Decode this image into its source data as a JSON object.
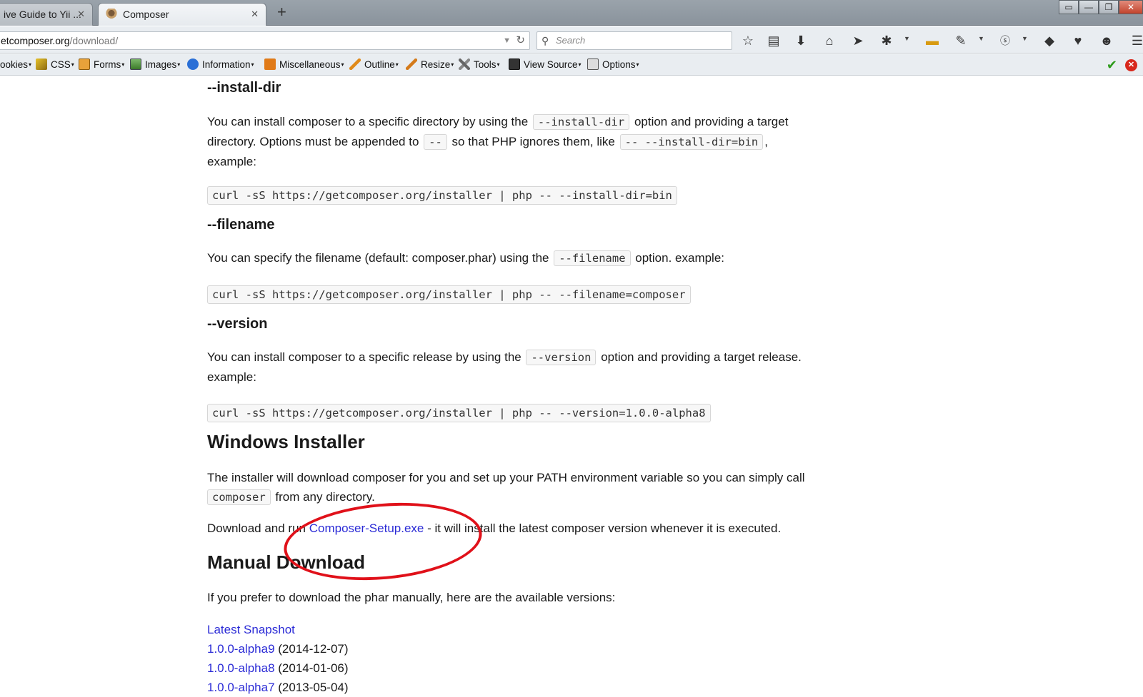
{
  "tabs": [
    {
      "label": "ive Guide to Yii ...",
      "close": "✕"
    },
    {
      "label": "Composer",
      "close": "✕"
    }
  ],
  "new_tab": "+",
  "window_controls": [
    "▭",
    "—",
    "❐",
    "✕"
  ],
  "navbar": {
    "url_host": "etcomposer.org",
    "url_path": "/download/",
    "search_placeholder": "Search",
    "icons": [
      "star-icon",
      "reading-list-icon",
      "download-icon",
      "home-icon",
      "send-icon",
      "bug-icon",
      "slides-icon",
      "dropper-icon",
      "s-badge-icon",
      "plugin-icon",
      "share-icon",
      "chat-icon",
      "menu-icon"
    ]
  },
  "devbar": {
    "items": [
      "ookies",
      "CSS",
      "Forms",
      "Images",
      "Information",
      "Miscellaneous",
      "Outline",
      "Resize",
      "Tools",
      "View Source",
      "Options"
    ],
    "caret": "▾",
    "ok": "✔",
    "error": "✕"
  },
  "page": {
    "install_dir": {
      "heading": "--install-dir",
      "p1_a": "You can install composer to a specific directory by using the ",
      "p1_code": "--install-dir",
      "p1_b": " option and providing a target",
      "p1_c": "directory. Options must be appended to ",
      "p1_code2": "--",
      "p1_d": " so that PHP ignores them, like ",
      "p1_code3": "-- --install-dir=bin",
      "p1_e": ",",
      "p1_f": "example:",
      "code": "curl -sS https://getcomposer.org/installer | php -- --install-dir=bin"
    },
    "filename": {
      "heading": "--filename",
      "p_a": "You can specify the filename (default: composer.phar) using the ",
      "p_code": "--filename",
      "p_b": " option. example:",
      "code": "curl -sS https://getcomposer.org/installer | php -- --filename=composer"
    },
    "version": {
      "heading": "--version",
      "p_a": "You can install composer to a specific release by using the ",
      "p_code": "--version",
      "p_b": " option and providing a target release.",
      "p_c": "example:",
      "code": "curl -sS https://getcomposer.org/installer | php -- --version=1.0.0-alpha8"
    },
    "windows": {
      "heading": "Windows Installer",
      "p1_a": "The installer will download composer for you and set up your PATH environment variable so you can simply call",
      "p1_code": "composer",
      "p1_b": " from any directory.",
      "p2_a": "Download and run ",
      "p2_link": "Composer-Setup.exe",
      "p2_b": " - it will install the latest composer version whenever it is executed."
    },
    "manual": {
      "heading": "Manual Download",
      "p": "If you prefer to download the phar manually, here are the available versions:",
      "versions": [
        {
          "link": "Latest Snapshot",
          "date": ""
        },
        {
          "link": "1.0.0-alpha9",
          "date": " (2014-12-07)"
        },
        {
          "link": "1.0.0-alpha8",
          "date": " (2014-01-06)"
        },
        {
          "link": "1.0.0-alpha7",
          "date": " (2013-05-04)"
        }
      ]
    }
  }
}
